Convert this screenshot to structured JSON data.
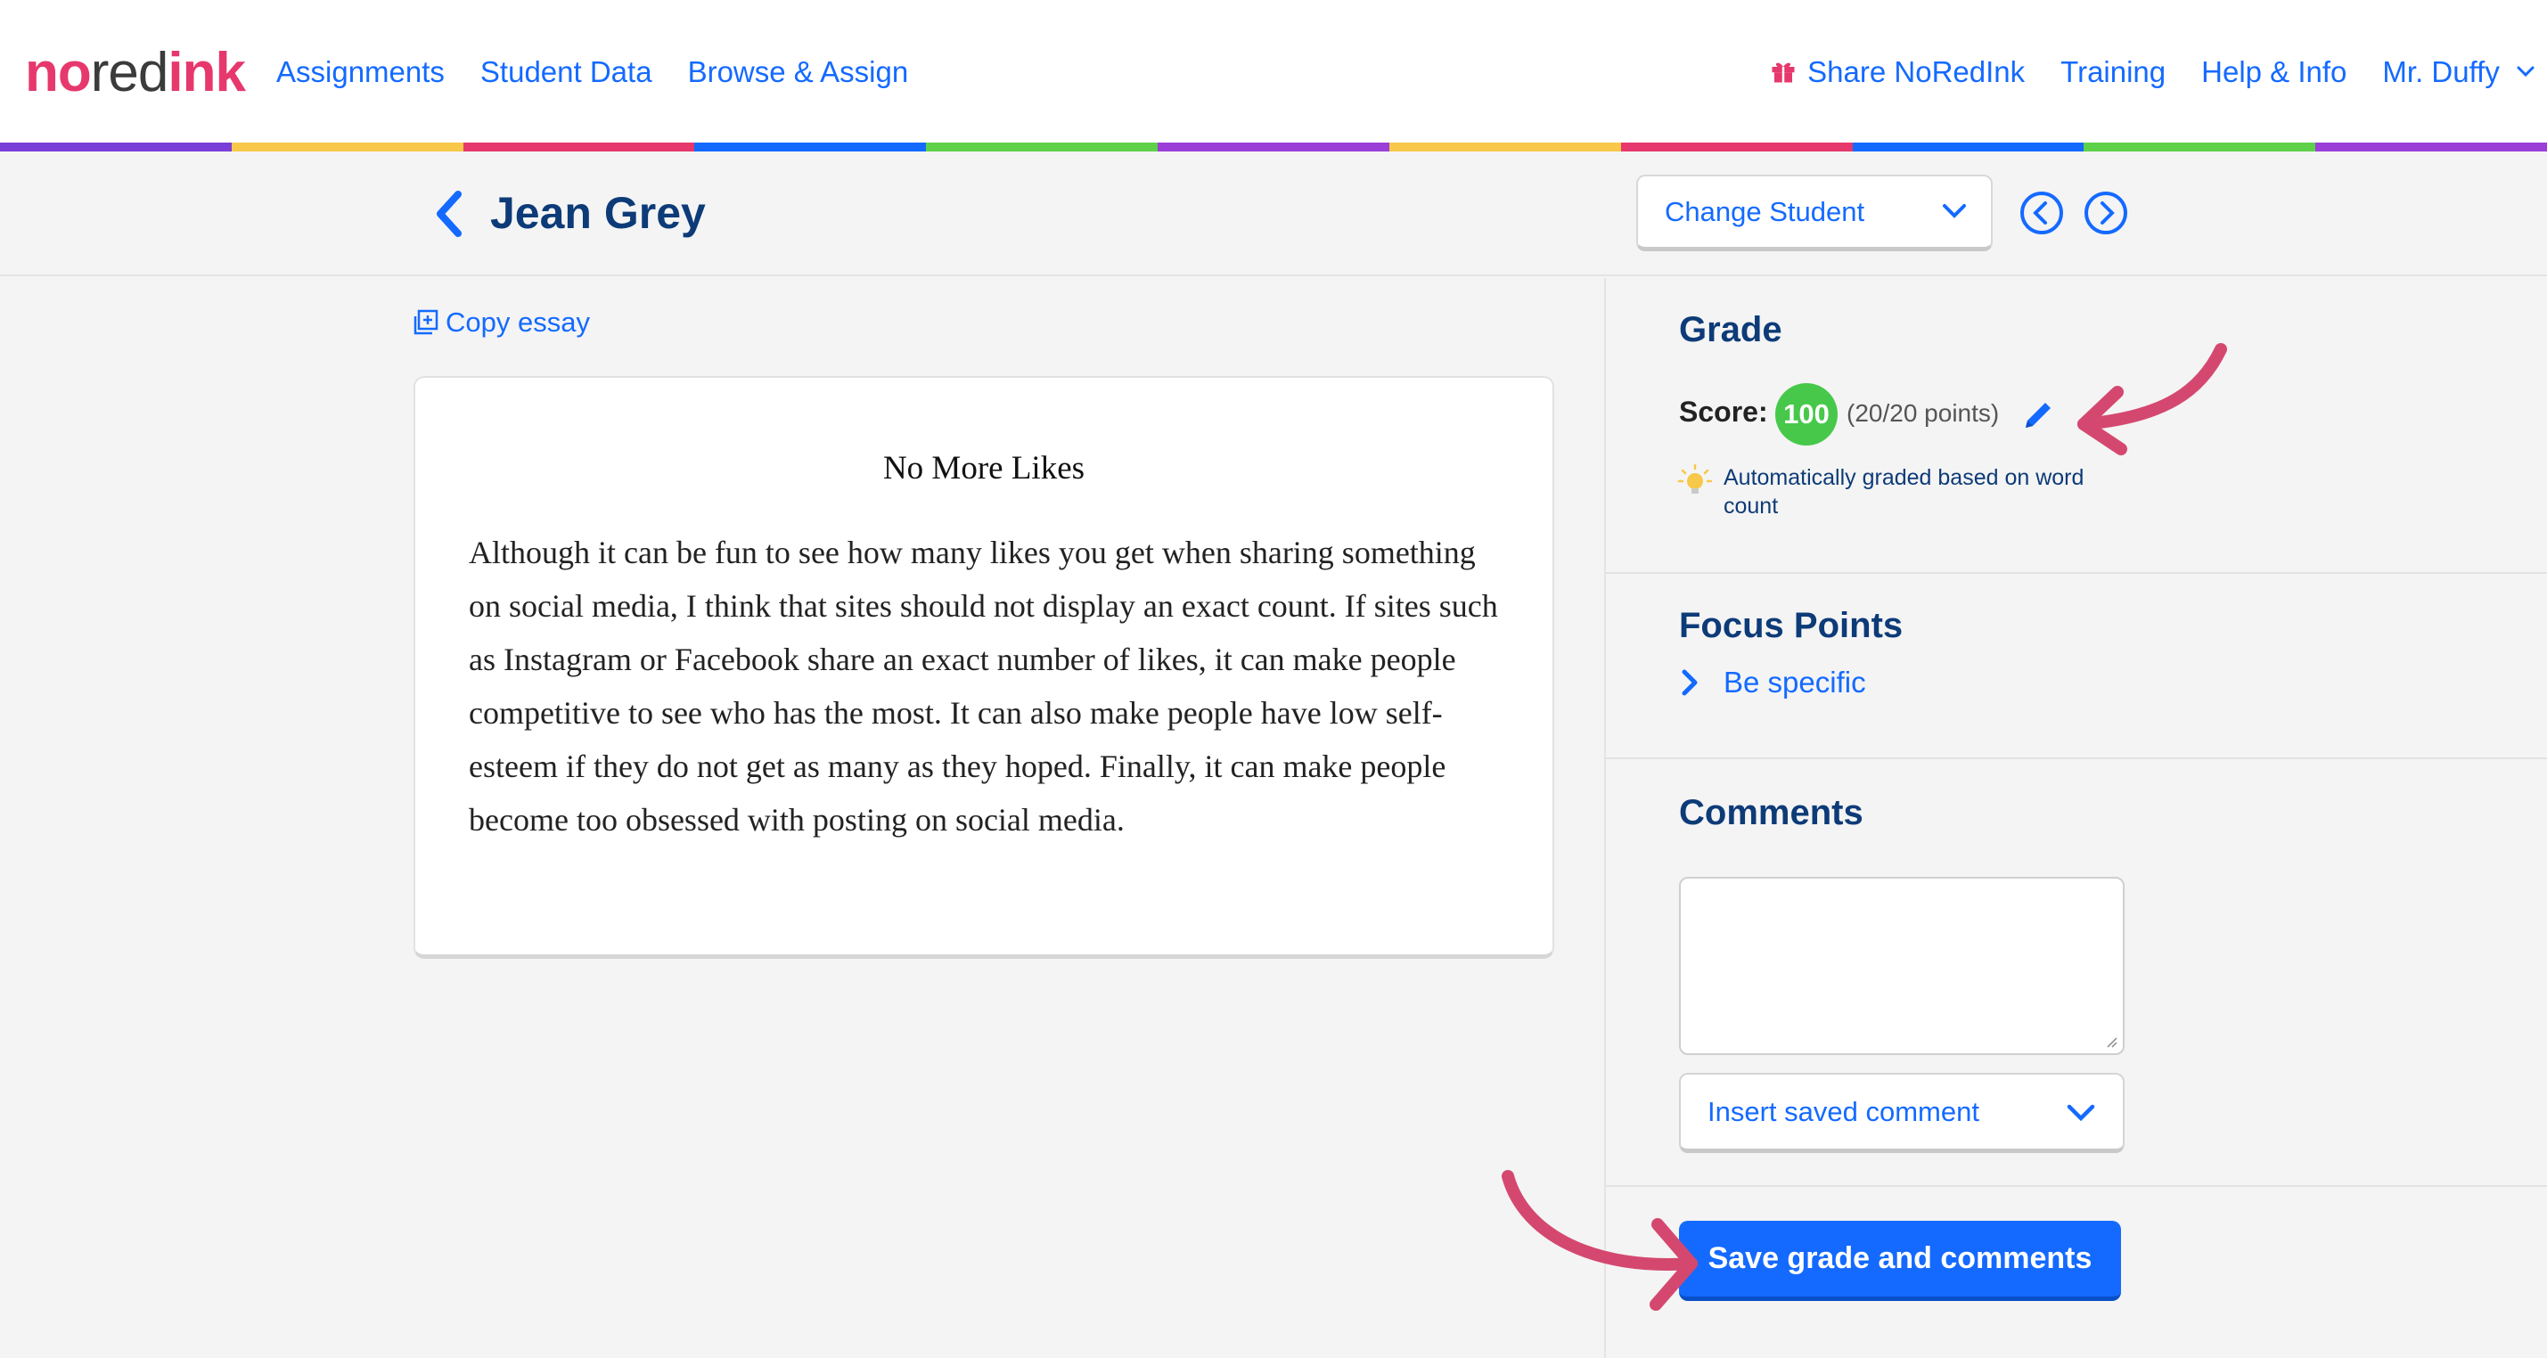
{
  "nav": {
    "logo": {
      "no": "no",
      "red": "red",
      "ink": "ink"
    },
    "links": [
      "Assignments",
      "Student Data",
      "Browse & Assign"
    ],
    "share": "Share NoRedInk",
    "training": "Training",
    "help": "Help & Info",
    "user": "Mr. Duffy"
  },
  "rainbow_colors": [
    "#7a3fd8",
    "#f7c84a",
    "#e6386d",
    "#146aff",
    "#5ed14a",
    "#9b3fd8",
    "#f7c84a",
    "#e6386d",
    "#146aff",
    "#5ed14a",
    "#9b3fd8"
  ],
  "header": {
    "student_name": "Jean Grey",
    "change_student": "Change Student"
  },
  "essay": {
    "copy_label": "Copy essay",
    "title": "No More Likes",
    "body": "Although it can be fun to see how many likes you get when sharing something on social media, I think that sites should not display an exact count. If sites such as Instagram or Facebook share an exact number of likes, it can make people competitive to see who has the most. It can also make people have low self-esteem if they do not get as many as they hoped. Finally, it can make people become too obsessed with posting on social media."
  },
  "grade": {
    "title": "Grade",
    "score_label": "Score:",
    "score": "100",
    "points": "(20/20 points)",
    "auto_note": "Automatically graded based on word count"
  },
  "focus": {
    "title": "Focus Points",
    "items": [
      "Be specific"
    ]
  },
  "comments": {
    "title": "Comments",
    "value": "",
    "insert_saved": "Insert saved comment"
  },
  "save_button": "Save grade and comments",
  "colors": {
    "accent": "#146aff",
    "navy": "#0d3b78",
    "brand_pink": "#e6386d",
    "score_green": "#47c84a",
    "annotation_arrow": "#d4486f"
  }
}
